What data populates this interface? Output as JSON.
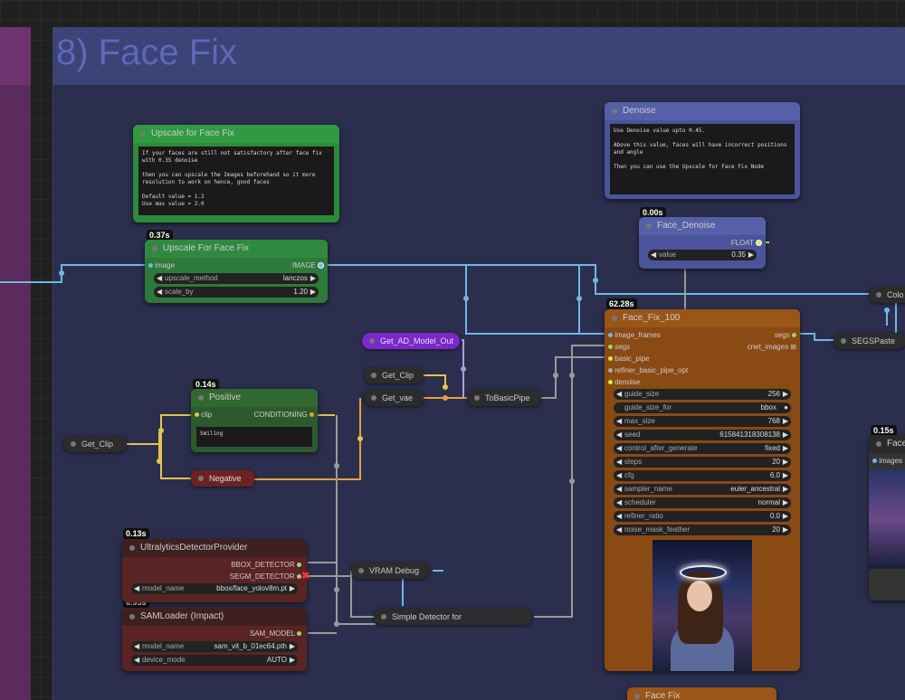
{
  "group": {
    "title": "8) Face Fix"
  },
  "timings": {
    "upscale": "0.37s",
    "positive": "0.14s",
    "denoise": "0.00s",
    "facefix": "62.28s",
    "ultra": "0.13s",
    "sam": "0.95s",
    "right": "0.15s"
  },
  "notes": {
    "upscale": {
      "title": "Upscale for Face Fix",
      "text": "If your faces are still not satisfactory after face fix with 0.35 denoise\n\nthen you can upscale the Images beforehand so it more resolution to work on hence, good faces\n\nDefault value = 1.2\nUse max value = 2.0"
    },
    "denoise": {
      "title": "Denoise",
      "text": "Use Denoise value upto 0.45.\n\nAbove this value, faces will have incorrect positions and angle\n\nThen you can use the Upscale for Face Fix Node"
    }
  },
  "upscale_node": {
    "title": "Upscale For Face Fix",
    "in": "image",
    "out": "IMAGE",
    "w1_label": "upscale_method",
    "w1_value": "lanczos",
    "w2_label": "scale_by",
    "w2_value": "1.20"
  },
  "face_denoise": {
    "title": "Face_Denoise",
    "out": "FLOAT",
    "w_label": "value",
    "w_value": "0.35"
  },
  "positive": {
    "title": "Positive",
    "in": "clip",
    "out": "CONDITIONING",
    "text": "Smiling"
  },
  "negative": {
    "title": "Negative"
  },
  "pills": {
    "get_clip_left": "Get_Clip",
    "get_clip": "Get_Clip",
    "get_vae": "Get_vae",
    "get_ad": "Get_AD_Model_Out",
    "to_basic": "ToBasicPipe",
    "vram": "VRAM Debug",
    "simple_det": "Simple Detector for",
    "segs_paste": "SEGSPaste",
    "color": "Colo"
  },
  "ultra": {
    "title": "UltralyticsDetectorProvider",
    "out1": "BBOX_DETECTOR",
    "out2": "SEGM_DETECTOR",
    "w_label": "model_name",
    "w_value": "bbox/face_yolov8m.pt"
  },
  "sam": {
    "title": "SAMLoader (Impact)",
    "out": "SAM_MODEL",
    "w1_label": "model_name",
    "w1_value": "sam_vit_b_01ec64.pth",
    "w2_label": "device_mode",
    "w2_value": "AUTO"
  },
  "facefix": {
    "title": "Face_Fix_100",
    "inputs": [
      "image_frames",
      "segs",
      "basic_pipe",
      "refiner_basic_pipe_opt",
      "denoise"
    ],
    "outputs": [
      "segs",
      "cnet_images"
    ],
    "widgets": [
      {
        "label": "guide_size",
        "value": "256"
      },
      {
        "label": "guide_size_for",
        "value": "bbox"
      },
      {
        "label": "max_size",
        "value": "768"
      },
      {
        "label": "seed",
        "value": "615841318308138"
      },
      {
        "label": "control_after_generate",
        "value": "fixed"
      },
      {
        "label": "steps",
        "value": "20"
      },
      {
        "label": "cfg",
        "value": "6.0"
      },
      {
        "label": "sampler_name",
        "value": "euler_ancestral"
      },
      {
        "label": "scheduler",
        "value": "normal"
      },
      {
        "label": "refiner_ratio",
        "value": "0.0"
      },
      {
        "label": "noise_mask_feather",
        "value": "20"
      }
    ]
  },
  "right_node": {
    "title": "Face",
    "in": "images"
  },
  "bottom_node": {
    "title": "Face Fix"
  }
}
